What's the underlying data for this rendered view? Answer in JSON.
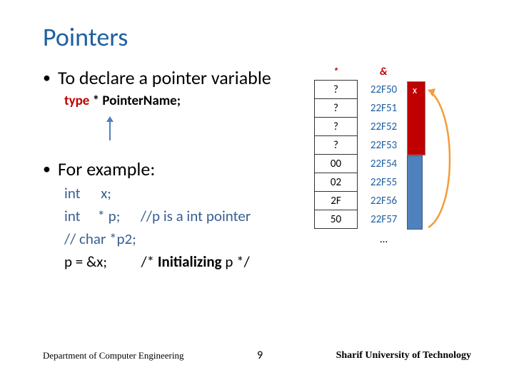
{
  "title": "Pointers",
  "bullets": {
    "b1": "To declare a pointer variable",
    "b2": "For example:"
  },
  "syntax": {
    "type": "type",
    "star": " * ",
    "pname": "PointerName;"
  },
  "code": {
    "l1a": "int",
    "l1b": "x;",
    "l2a": "int",
    "l2b": "* p;",
    "l2c": "//p is a int pointer",
    "l3": "// char   *p2;",
    "l4a": "p = &x;",
    "l4b": "/* ",
    "l4c": "Initializing",
    "l4d": " p */"
  },
  "table": {
    "hdr_star": "*",
    "hdr_amp": "&",
    "rows": [
      {
        "val": "?",
        "addr": "22F50"
      },
      {
        "val": "?",
        "addr": "22F51"
      },
      {
        "val": "?",
        "addr": "22F52"
      },
      {
        "val": "?",
        "addr": "22F53"
      },
      {
        "val": "00",
        "addr": "22F54"
      },
      {
        "val": "02",
        "addr": "22F55"
      },
      {
        "val": "2F",
        "addr": "22F56"
      },
      {
        "val": "50",
        "addr": "22F57"
      }
    ],
    "dots": "…"
  },
  "x_label": "x",
  "footer": {
    "dept": "Department of Computer Engineering",
    "page": "9",
    "uni": "Sharif University of Technology"
  }
}
